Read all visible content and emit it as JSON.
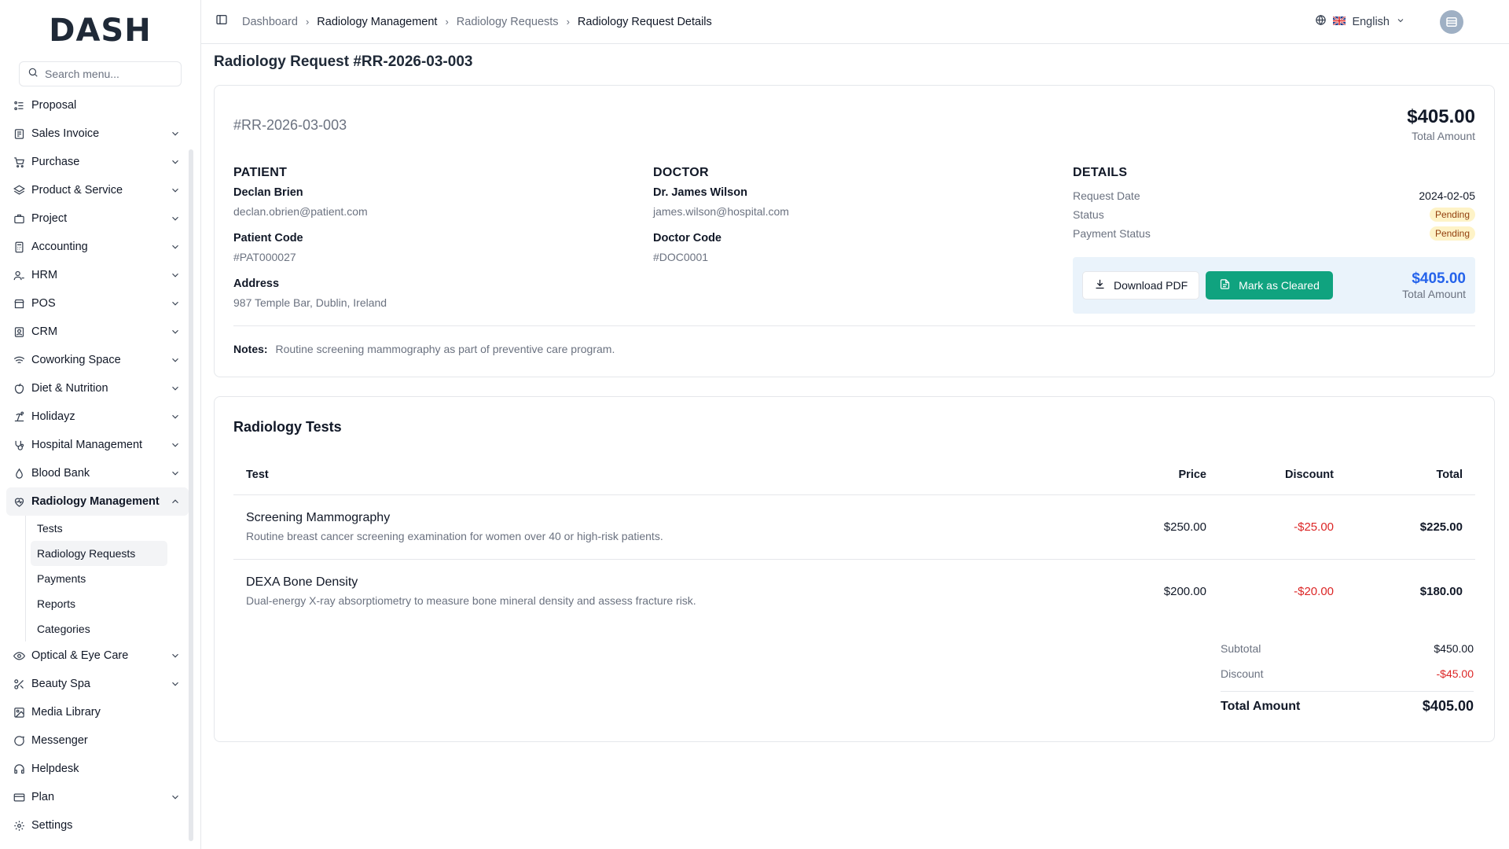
{
  "app": {
    "logo": "DASH"
  },
  "search": {
    "placeholder": "Search menu..."
  },
  "sidebar": {
    "items": [
      {
        "label": "Proposal",
        "icon": "proposal-icon",
        "expandable": false
      },
      {
        "label": "Sales Invoice",
        "icon": "invoice-icon",
        "expandable": true
      },
      {
        "label": "Purchase",
        "icon": "cart-icon",
        "expandable": true
      },
      {
        "label": "Product & Service",
        "icon": "layers-icon",
        "expandable": true
      },
      {
        "label": "Project",
        "icon": "briefcase-icon",
        "expandable": true
      },
      {
        "label": "Accounting",
        "icon": "calculator-icon",
        "expandable": true
      },
      {
        "label": "HRM",
        "icon": "users-icon",
        "expandable": true
      },
      {
        "label": "POS",
        "icon": "store-icon",
        "expandable": true
      },
      {
        "label": "CRM",
        "icon": "contact-icon",
        "expandable": true
      },
      {
        "label": "Coworking Space",
        "icon": "wifi-icon",
        "expandable": true
      },
      {
        "label": "Diet & Nutrition",
        "icon": "apple-icon",
        "expandable": true
      },
      {
        "label": "Holidayz",
        "icon": "beach-icon",
        "expandable": true
      },
      {
        "label": "Hospital Management",
        "icon": "stethoscope-icon",
        "expandable": true
      },
      {
        "label": "Blood Bank",
        "icon": "droplet-icon",
        "expandable": true
      },
      {
        "label": "Radiology Management",
        "icon": "radiology-icon",
        "expandable": true,
        "active": true
      }
    ],
    "radiology_sub": [
      "Tests",
      "Radiology Requests",
      "Payments",
      "Reports",
      "Categories"
    ],
    "items_after": [
      {
        "label": "Optical & Eye Care",
        "icon": "eye-icon",
        "expandable": true
      },
      {
        "label": "Beauty Spa",
        "icon": "scissors-icon",
        "expandable": true
      },
      {
        "label": "Media Library",
        "icon": "image-icon",
        "expandable": false
      },
      {
        "label": "Messenger",
        "icon": "message-icon",
        "expandable": false
      },
      {
        "label": "Helpdesk",
        "icon": "headset-icon",
        "expandable": false
      },
      {
        "label": "Plan",
        "icon": "card-icon",
        "expandable": true
      },
      {
        "label": "Settings",
        "icon": "gear-icon",
        "expandable": false
      }
    ]
  },
  "breadcrumb": [
    "Dashboard",
    "Radiology Management",
    "Radiology Requests",
    "Radiology Request Details"
  ],
  "language": {
    "label": "English"
  },
  "page": {
    "title": "Radiology Request #RR-2026-03-003",
    "request_id": "#RR-2026-03-003",
    "total_amount": "$405.00",
    "total_caption": "Total Amount"
  },
  "patient": {
    "heading": "PATIENT",
    "name": "Declan Brien",
    "email": "declan.obrien@patient.com",
    "code_label": "Patient Code",
    "code": "#PAT000027",
    "address_label": "Address",
    "address": "987 Temple Bar, Dublin, Ireland"
  },
  "doctor": {
    "heading": "DOCTOR",
    "name": "Dr. James Wilson",
    "email": "james.wilson@hospital.com",
    "code_label": "Doctor Code",
    "code": "#DOC0001"
  },
  "details": {
    "heading": "DETAILS",
    "request_date_label": "Request Date",
    "request_date": "2024-02-05",
    "status_label": "Status",
    "status": "Pending",
    "payment_status_label": "Payment Status",
    "payment_status": "Pending"
  },
  "actions": {
    "download": "Download PDF",
    "mark_cleared": "Mark as Cleared",
    "total": "$405.00",
    "total_caption": "Total Amount"
  },
  "notes": {
    "label": "Notes:",
    "text": "Routine screening mammography as part of preventive care program."
  },
  "tests": {
    "title": "Radiology Tests",
    "columns": [
      "Test",
      "Price",
      "Discount",
      "Total"
    ],
    "rows": [
      {
        "name": "Screening Mammography",
        "desc": "Routine breast cancer screening examination for women over 40 or high-risk patients.",
        "price": "$250.00",
        "discount": "-$25.00",
        "total": "$225.00"
      },
      {
        "name": "DEXA Bone Density",
        "desc": "Dual-energy X-ray absorptiometry to measure bone mineral density and assess fracture risk.",
        "price": "$200.00",
        "discount": "-$20.00",
        "total": "$180.00"
      }
    ],
    "subtotal_label": "Subtotal",
    "subtotal": "$450.00",
    "discount_label": "Discount",
    "discount": "-$45.00",
    "total_label": "Total Amount",
    "total": "$405.00"
  },
  "colors": {
    "accent": "#10a37f",
    "blue": "#2563eb",
    "danger": "#dc2626",
    "badge_bg": "#fef3c7"
  }
}
